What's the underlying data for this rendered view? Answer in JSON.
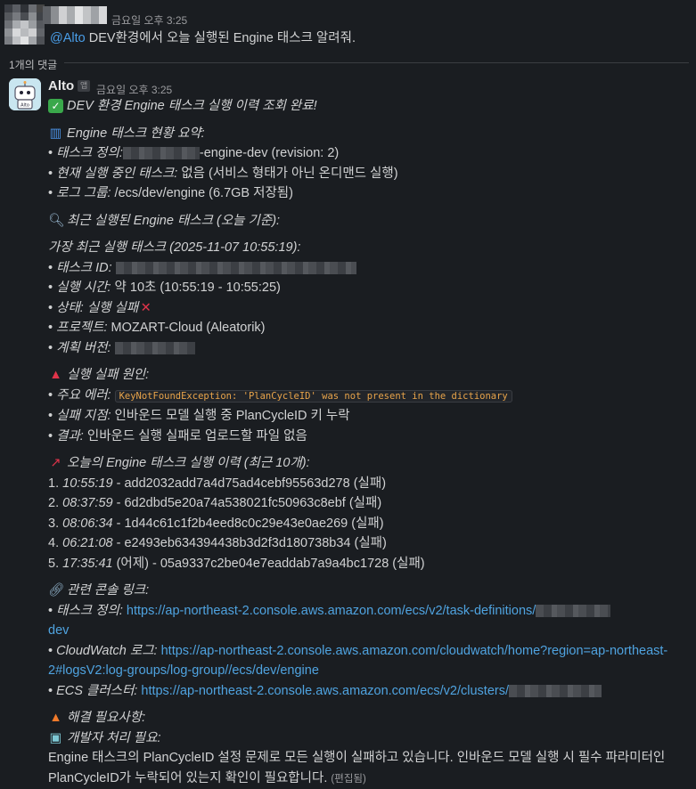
{
  "user_message": {
    "timestamp": "금요일 오후 3:25",
    "mention": "@Alto",
    "text": " DEV환경에서 오늘 실행된 Engine 태스크 알려줘."
  },
  "thread": {
    "reply_count": "1개의 댓글"
  },
  "bot": {
    "name": "Alto",
    "badge": "앱",
    "timestamp": "금요일 오후 3:25",
    "avatar_label": "Alto"
  },
  "reply": {
    "headline": "DEV 환경 Engine 태스크 실행 이력 조회 완료!",
    "summary": {
      "title": "Engine 태스크 현황 요약:",
      "task_def_label": "태스크 정의:",
      "task_def_value": "-engine-dev (revision: 2)",
      "running_label": "현재 실행 중인 태스크:",
      "running_value": " 없음 (서비스 형태가 아닌 온디맨드 실행)",
      "log_label": "로그 그룹:",
      "log_value": " /ecs/dev/engine (6.7GB 저장됨)"
    },
    "recent": {
      "title": "최근 실행된 Engine 태스크 (오늘 기준):",
      "latest_title": "가장 최근 실행 태스크 (2025-11-07 10:55:19):",
      "task_id_label": "태스크 ID:",
      "runtime_label": "실행 시간:",
      "runtime_value": " 약 10초 (10:55:19 - 10:55:25)",
      "status_label": "상태: 실행 실패",
      "project_label": "프로젝트:",
      "project_value": " MOZART-Cloud (Aleatorik)",
      "plan_label": "계획 버전:"
    },
    "failure": {
      "title": "실행 실패 원인:",
      "error_label": "주요 에러:",
      "error_code": "KeyNotFoundException: 'PlanCycleID' was not present in the dictionary",
      "point_label": "실패 지점:",
      "point_value": " 인바운드 모델 실행 중 PlanCycleID 키 누락",
      "result_label": "결과:",
      "result_value": " 인바운드 실행 실패로 업로드할 파일 없음"
    },
    "history": {
      "title": "오늘의 Engine 태스크 실행 이력 (최근 10개):",
      "items": [
        {
          "num": "1.",
          "time": "10:55:19",
          "rest": " - add2032add7a4d75ad4cebf95563d278 (실패)"
        },
        {
          "num": "2.",
          "time": "08:37:59",
          "rest": " - 6d2dbd5e20a74a538021fc50963c8ebf (실패)"
        },
        {
          "num": "3.",
          "time": "08:06:34",
          "rest": " - 1d44c61c1f2b4eed8c0c29e43e0ae269 (실패)"
        },
        {
          "num": "4.",
          "time": "06:21:08",
          "rest": " - e2493eb634394438b3d2f3d180738b34 (실패)"
        },
        {
          "num": "5.",
          "time": "17:35:41",
          "rest": " (어제) - 05a9337c2be04e7eaddab7a9a4bc1728 (실패)"
        }
      ]
    },
    "links": {
      "title": "관련 콘솔 링크:",
      "taskdef_label": "태스크 정의:",
      "taskdef_url": "https://ap-northeast-2.console.aws.amazon.com/ecs/v2/task-definitions/",
      "taskdef_url_tail": "dev",
      "cw_label": "CloudWatch 로그:",
      "cw_url_1": "https://ap-northeast-2.console.aws.amazon.com/cloudwatch/home?region=ap-northeast-",
      "cw_url_2": "2#logsV2:log-groups/log-group//ecs/dev/engine",
      "ecs_label": "ECS 클러스터:",
      "ecs_url": "https://ap-northeast-2.console.aws.amazon.com/ecs/v2/clusters/"
    },
    "action": {
      "title": "해결 필요사항:",
      "dev_title": "개발자 처리 필요:",
      "line1": "Engine 태스크의 PlanCycleID 설정 문제로 모든 실행이 실패하고 있습니다. 인바운드 모델 실행 시 필수 파라미터인",
      "line2": "PlanCycleID가 누락되어 있는지 확인이 필요합니다.",
      "edited": "(편집됨)"
    }
  },
  "colors": {
    "background": "#1a1d21",
    "text": "#d1d2d3",
    "link": "#4fa3e0",
    "mention": "#4a9ee8",
    "code": "#e8a44a"
  }
}
